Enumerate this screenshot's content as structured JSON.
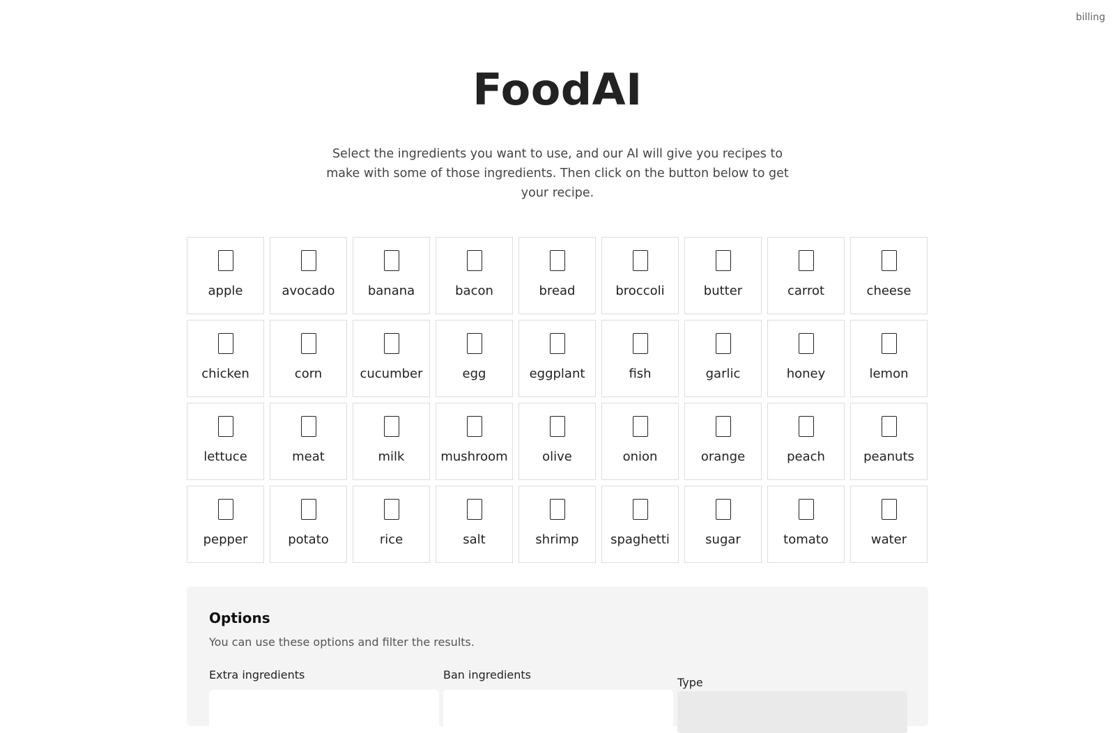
{
  "header": {
    "billing_link": "billing"
  },
  "hero": {
    "title": "FoodAI",
    "description": "Select the ingredients you want to use, and our AI will give you recipes to make with some of those ingredients. Then click on the button below to get your recipe."
  },
  "ingredients": [
    {
      "label": "apple",
      "icon": "apple-emoji-icon"
    },
    {
      "label": "avocado",
      "icon": "avocado-emoji-icon"
    },
    {
      "label": "banana",
      "icon": "banana-emoji-icon"
    },
    {
      "label": "bacon",
      "icon": "bacon-emoji-icon"
    },
    {
      "label": "bread",
      "icon": "bread-emoji-icon"
    },
    {
      "label": "broccoli",
      "icon": "broccoli-emoji-icon"
    },
    {
      "label": "butter",
      "icon": "butter-emoji-icon"
    },
    {
      "label": "carrot",
      "icon": "carrot-emoji-icon"
    },
    {
      "label": "cheese",
      "icon": "cheese-emoji-icon"
    },
    {
      "label": "chicken",
      "icon": "chicken-emoji-icon"
    },
    {
      "label": "corn",
      "icon": "corn-emoji-icon"
    },
    {
      "label": "cucumber",
      "icon": "cucumber-emoji-icon"
    },
    {
      "label": "egg",
      "icon": "egg-emoji-icon"
    },
    {
      "label": "eggplant",
      "icon": "eggplant-emoji-icon"
    },
    {
      "label": "fish",
      "icon": "fish-emoji-icon"
    },
    {
      "label": "garlic",
      "icon": "garlic-emoji-icon"
    },
    {
      "label": "honey",
      "icon": "honey-emoji-icon"
    },
    {
      "label": "lemon",
      "icon": "lemon-emoji-icon"
    },
    {
      "label": "lettuce",
      "icon": "lettuce-emoji-icon"
    },
    {
      "label": "meat",
      "icon": "meat-emoji-icon"
    },
    {
      "label": "milk",
      "icon": "milk-emoji-icon"
    },
    {
      "label": "mushroom",
      "icon": "mushroom-emoji-icon"
    },
    {
      "label": "olive",
      "icon": "olive-emoji-icon"
    },
    {
      "label": "onion",
      "icon": "onion-emoji-icon"
    },
    {
      "label": "orange",
      "icon": "orange-emoji-icon"
    },
    {
      "label": "peach",
      "icon": "peach-emoji-icon"
    },
    {
      "label": "peanuts",
      "icon": "peanuts-emoji-icon"
    },
    {
      "label": "pepper",
      "icon": "pepper-emoji-icon"
    },
    {
      "label": "potato",
      "icon": "potato-emoji-icon"
    },
    {
      "label": "rice",
      "icon": "rice-emoji-icon"
    },
    {
      "label": "salt",
      "icon": "salt-emoji-icon"
    },
    {
      "label": "shrimp",
      "icon": "shrimp-emoji-icon"
    },
    {
      "label": "spaghetti",
      "icon": "spaghetti-emoji-icon"
    },
    {
      "label": "sugar",
      "icon": "sugar-emoji-icon"
    },
    {
      "label": "tomato",
      "icon": "tomato-emoji-icon"
    },
    {
      "label": "water",
      "icon": "water-emoji-icon"
    }
  ],
  "options": {
    "title": "Options",
    "description": "You can use these options and filter the results.",
    "extra_ingredients": {
      "label": "Extra ingredients",
      "value": ""
    },
    "ban_ingredients": {
      "label": "Ban ingredients",
      "value": ""
    },
    "type": {
      "label": "Type"
    }
  }
}
